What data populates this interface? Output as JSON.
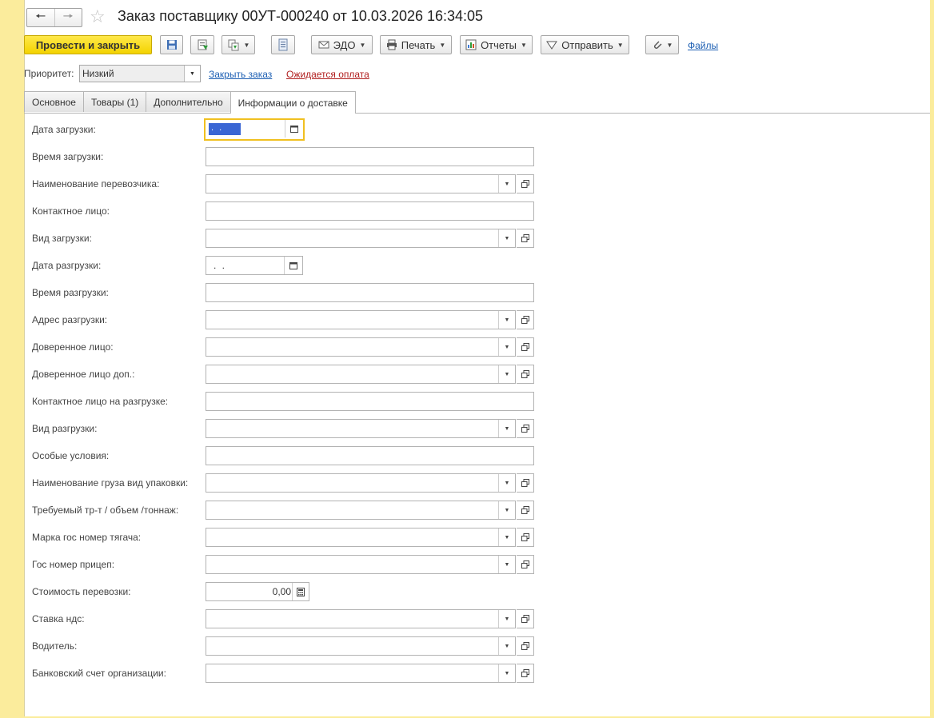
{
  "window": {
    "title": "Заказ поставщику 00УТ-000240 от 10.03.2026 16:34:05"
  },
  "toolbar": {
    "post_close_label": "Провести и закрыть",
    "edo_label": "ЭДО",
    "print_label": "Печать",
    "reports_label": "Отчеты",
    "send_label": "Отправить",
    "files_label": "Файлы"
  },
  "priority": {
    "label": "Приоритет:",
    "value": "Низкий",
    "close_order_link": "Закрыть заказ",
    "status_link": "Ожидается оплата"
  },
  "tabs": [
    {
      "label": "Основное",
      "active": false
    },
    {
      "label": "Товары (1)",
      "active": false
    },
    {
      "label": "Дополнительно",
      "active": false
    },
    {
      "label": "Информации о доставке",
      "active": true
    }
  ],
  "form": {
    "load_date": {
      "label": "Дата загрузки:",
      "value": ". ."
    },
    "load_time": {
      "label": "Время загрузки:"
    },
    "carrier": {
      "label": "Наименование перевозчика:"
    },
    "contact": {
      "label": "Контактное лицо:"
    },
    "load_type": {
      "label": "Вид загрузки:"
    },
    "unload_date": {
      "label": "Дата разгрузки:",
      "value": ". ."
    },
    "unload_time": {
      "label": "Время разгрузки:"
    },
    "unload_address": {
      "label": "Адрес разгрузки:"
    },
    "trusted_person": {
      "label": "Доверенное лицо:"
    },
    "trusted_person_extra": {
      "label": "Доверенное лицо доп.:"
    },
    "unload_contact": {
      "label": "Контактное лицо на разгрузке:"
    },
    "unload_type": {
      "label": "Вид разгрузки:"
    },
    "special_conditions": {
      "label": "Особые условия:"
    },
    "cargo_name": {
      "label": "Наименование груза вид упаковки:"
    },
    "transport_required": {
      "label": "Требуемый тр-т / объем /тоннаж:"
    },
    "tractor_plate": {
      "label": "Марка гос номер тягача:"
    },
    "trailer_plate": {
      "label": "Гос номер прицеп:"
    },
    "shipping_cost": {
      "label": "Стоимость перевозки:",
      "value": "0,00"
    },
    "vat_rate": {
      "label": "Ставка ндс:"
    },
    "driver": {
      "label": "Водитель:"
    },
    "bank_account": {
      "label": "Банковский счет организации:"
    }
  }
}
